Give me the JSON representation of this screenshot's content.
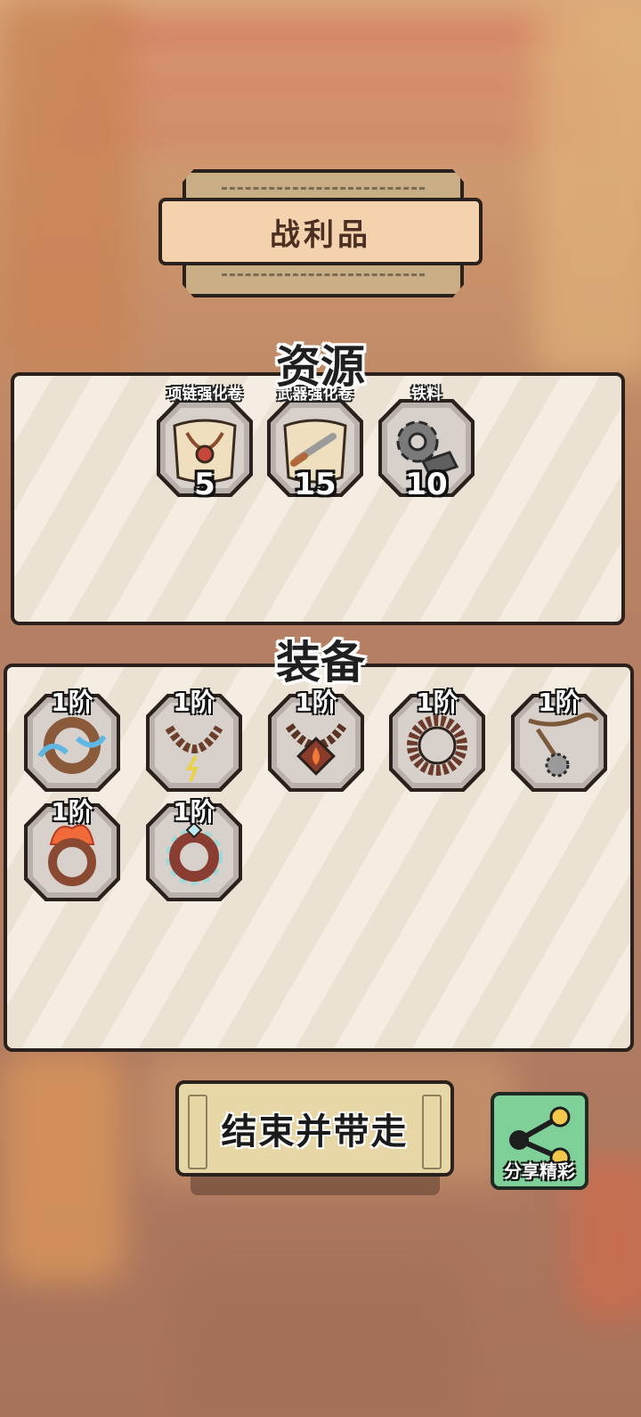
{
  "title": "战利品",
  "resources": {
    "heading": "资源",
    "items": [
      {
        "name": "项链强化卷",
        "count": "5",
        "icon": "necklace-scroll-icon"
      },
      {
        "name": "武器强化卷",
        "count": "15",
        "icon": "weapon-scroll-icon"
      },
      {
        "name": "铁料",
        "count": "10",
        "icon": "iron-gear-icon"
      }
    ]
  },
  "equipment": {
    "heading": "装备",
    "items": [
      {
        "tier": "1阶",
        "icon": "water-ring-icon"
      },
      {
        "tier": "1阶",
        "icon": "lightning-bead-necklace-icon"
      },
      {
        "tier": "1阶",
        "icon": "fire-gem-necklace-icon"
      },
      {
        "tier": "1阶",
        "icon": "spiked-ring-icon"
      },
      {
        "tier": "1阶",
        "icon": "saw-blade-necklace-icon"
      },
      {
        "tier": "1阶",
        "icon": "flame-ring-icon"
      },
      {
        "tier": "1阶",
        "icon": "frost-ring-icon"
      }
    ]
  },
  "buttons": {
    "end": "结束并带走",
    "share": "分享精彩"
  }
}
